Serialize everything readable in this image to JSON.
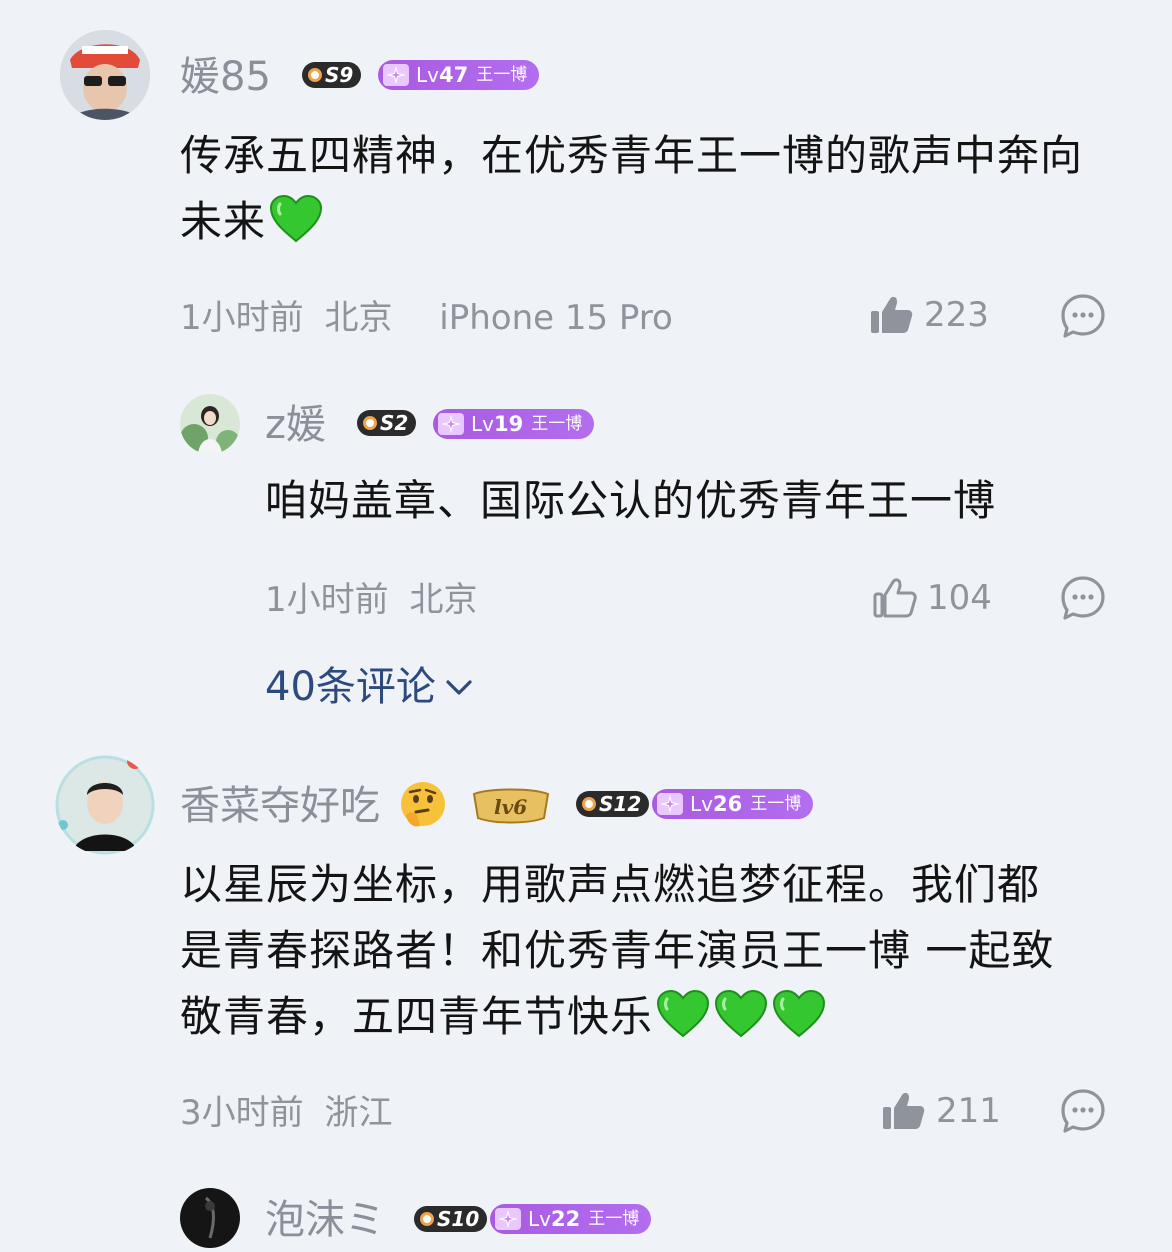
{
  "comments": [
    {
      "username": "媛85",
      "s_badge": "S9",
      "lv_prefix": "Lv",
      "lv_num": "47",
      "fan_name": "王一博",
      "text": "传承五四精神，在优秀青年王一博的歌声中奔向未来",
      "time": "1小时前",
      "location": "北京",
      "device": "iPhone 15 Pro",
      "likes": "223",
      "like_style": "filled"
    },
    {
      "username": "z媛",
      "s_badge": "S2",
      "lv_prefix": "Lv",
      "lv_num": "19",
      "fan_name": "王一博",
      "text": "咱妈盖章、国际公认的优秀青年王一博",
      "time": "1小时前",
      "location": "北京",
      "likes": "104",
      "like_style": "outline",
      "is_reply": true
    },
    {
      "username": "香菜夺好吃",
      "medal": "lv6",
      "s_badge": "S12",
      "lv_prefix": "Lv",
      "lv_num": "26",
      "fan_name": "王一博",
      "text_line1": "以星辰为坐标，用歌声点燃追梦征程。我们都",
      "text_line2": "是青春探路者！和优秀青年演员王一博 一起致",
      "text_line3": "敬青春，五四青年节快乐",
      "time": "3小时前",
      "location": "浙江",
      "likes": "211",
      "like_style": "filled"
    },
    {
      "username": "泡沫ミ",
      "s_badge": "S10",
      "lv_prefix": "Lv",
      "lv_num": "22",
      "fan_name": "王一博"
    }
  ],
  "expand_replies": "40条评论",
  "colors": {
    "background": "#eff2f6",
    "lv_badge": "#a95ae0",
    "link": "#2d4a7e",
    "meta": "#8f949c",
    "heart": "#3fcf3a"
  },
  "icons": [
    "thumbs-up-filled-icon",
    "thumbs-up-outline-icon",
    "comment-bubble-icon",
    "chevron-down-icon",
    "green-heart-icon",
    "thinking-face-icon"
  ]
}
